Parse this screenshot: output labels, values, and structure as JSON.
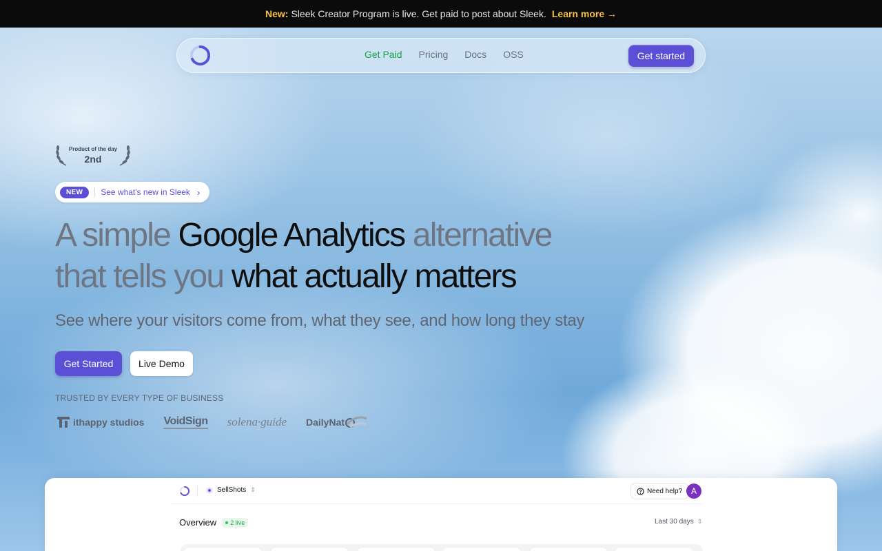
{
  "announcement": {
    "new_label": "New:",
    "text": "Sleek Creator Program is live. Get paid to post about Sleek.",
    "link": "Learn more →"
  },
  "nav": {
    "links": [
      "Get Paid",
      "Pricing",
      "Docs",
      "OSS"
    ],
    "active_link": "Get Paid",
    "cta": "Get started"
  },
  "award": {
    "title": "Product of the day",
    "rank": "2nd"
  },
  "whats_new": {
    "badge": "NEW",
    "text": "See what's new in Sleek",
    "chevron": "›"
  },
  "hero": {
    "line1_a": "A simple ",
    "line1_b": "Google Analytics",
    "line1_c": " alternative",
    "line2_a": "that tells you ",
    "line2_b": "what actually matters",
    "subhead": "See where your visitors come from, what they see, and how long they stay",
    "primary_button": "Get Started",
    "secondary_button": "Live Demo"
  },
  "trusted": {
    "label": "TRUSTED BY EVERY TYPE OF BUSINESS",
    "logos": [
      "ithappy studios",
      "VoidSign",
      "solena·guide",
      "DailyNat"
    ]
  },
  "dashboard": {
    "project": "SellShots",
    "help": "Need help?",
    "avatar_initial": "A",
    "overview": "Overview",
    "live": "2 live",
    "range": "Last 30 days",
    "updown": "⇕"
  },
  "colors": {
    "accent": "#5b4fd6",
    "active_nav": "#16a34a",
    "announce_highlight": "#f5c04a",
    "avatar": "#7b2fbe"
  },
  "icons": {
    "logo": "ring-logo-icon",
    "help": "question-circle-icon",
    "chevron": "chevron-right-icon",
    "laurel": "laurel-icon"
  }
}
